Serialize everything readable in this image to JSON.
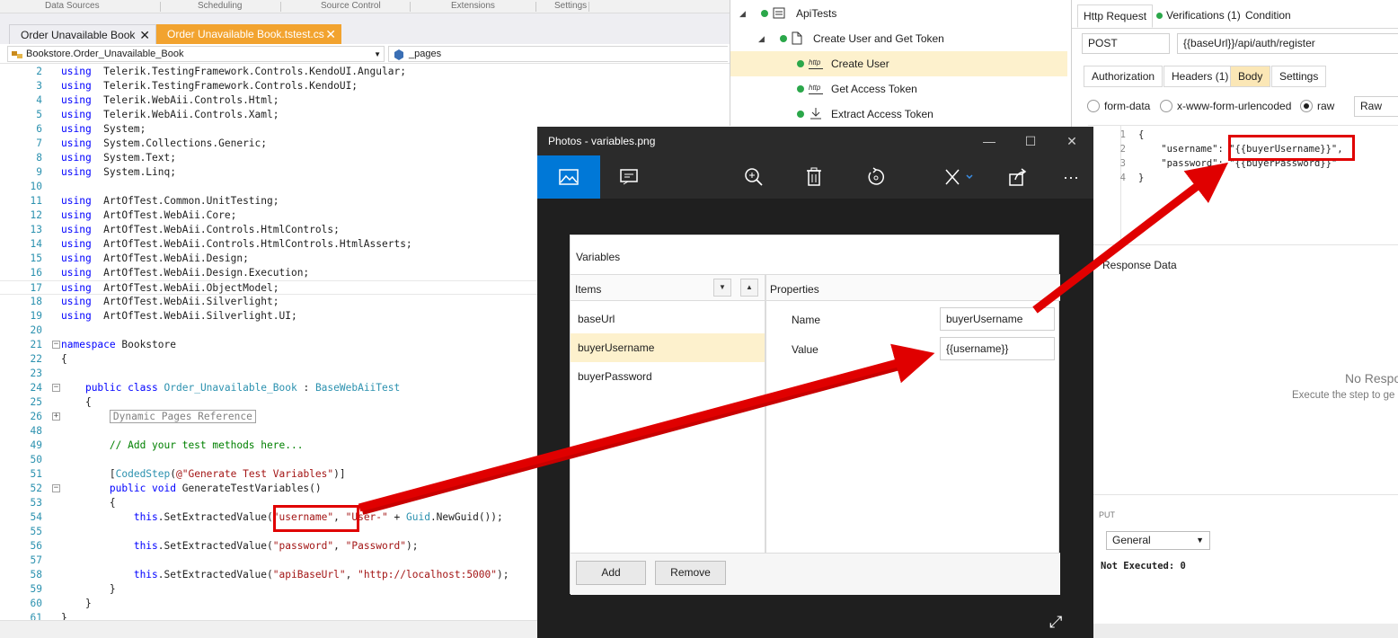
{
  "ribbon": [
    "Data Sources",
    "Scheduling",
    "Source Control",
    "Extensions",
    "Settings"
  ],
  "editor": {
    "tabs": [
      {
        "label": "Order Unavailable Book",
        "close": "✕"
      },
      {
        "label": "Order Unavailable Book.tstest.cs",
        "close": "✕"
      }
    ],
    "nav_class": "Bookstore.Order_Unavailable_Book",
    "nav_member": "_pages",
    "lines": [
      {
        "n": "2",
        "t": [
          [
            "kw",
            "using"
          ],
          [
            "",
            "  Telerik.TestingFramework.Controls.KendoUI.Angular;"
          ]
        ]
      },
      {
        "n": "3",
        "t": [
          [
            "kw",
            "using"
          ],
          [
            "",
            "  Telerik.TestingFramework.Controls.KendoUI;"
          ]
        ]
      },
      {
        "n": "4",
        "t": [
          [
            "kw",
            "using"
          ],
          [
            "",
            "  Telerik.WebAii.Controls.Html;"
          ]
        ]
      },
      {
        "n": "5",
        "t": [
          [
            "kw",
            "using"
          ],
          [
            "",
            "  Telerik.WebAii.Controls.Xaml;"
          ]
        ]
      },
      {
        "n": "6",
        "t": [
          [
            "kw",
            "using"
          ],
          [
            "",
            "  System;"
          ]
        ]
      },
      {
        "n": "7",
        "t": [
          [
            "kw",
            "using"
          ],
          [
            "",
            "  System.Collections.Generic;"
          ]
        ]
      },
      {
        "n": "8",
        "t": [
          [
            "kw",
            "using"
          ],
          [
            "",
            "  System.Text;"
          ]
        ]
      },
      {
        "n": "9",
        "t": [
          [
            "kw",
            "using"
          ],
          [
            "",
            "  System.Linq;"
          ]
        ]
      },
      {
        "n": "10",
        "t": []
      },
      {
        "n": "11",
        "t": [
          [
            "kw",
            "using"
          ],
          [
            "",
            "  ArtOfTest.Common.UnitTesting;"
          ]
        ]
      },
      {
        "n": "12",
        "t": [
          [
            "kw",
            "using"
          ],
          [
            "",
            "  ArtOfTest.WebAii.Core;"
          ]
        ]
      },
      {
        "n": "13",
        "t": [
          [
            "kw",
            "using"
          ],
          [
            "",
            "  ArtOfTest.WebAii.Controls.HtmlControls;"
          ]
        ]
      },
      {
        "n": "14",
        "t": [
          [
            "kw",
            "using"
          ],
          [
            "",
            "  ArtOfTest.WebAii.Controls.HtmlControls.HtmlAsserts;"
          ]
        ]
      },
      {
        "n": "15",
        "t": [
          [
            "kw",
            "using"
          ],
          [
            "",
            "  ArtOfTest.WebAii.Design;"
          ]
        ]
      },
      {
        "n": "16",
        "t": [
          [
            "kw",
            "using"
          ],
          [
            "",
            "  ArtOfTest.WebAii.Design.Execution;"
          ]
        ]
      },
      {
        "n": "17",
        "t": [
          [
            "kw",
            "using"
          ],
          [
            "",
            "  ArtOfTest.WebAii.ObjectModel;"
          ]
        ]
      },
      {
        "n": "18",
        "t": [
          [
            "kw",
            "using"
          ],
          [
            "",
            "  ArtOfTest.WebAii.Silverlight;"
          ]
        ]
      },
      {
        "n": "19",
        "t": [
          [
            "kw",
            "using"
          ],
          [
            "",
            "  ArtOfTest.WebAii.Silverlight.UI;"
          ]
        ]
      },
      {
        "n": "20",
        "t": []
      },
      {
        "n": "21",
        "t": [
          [
            "kw",
            "namespace"
          ],
          [
            "",
            " Bookstore"
          ]
        ]
      },
      {
        "n": "22",
        "t": [
          [
            "",
            "{"
          ]
        ]
      },
      {
        "n": "23",
        "t": []
      },
      {
        "n": "24",
        "t": [
          [
            "",
            "    "
          ],
          [
            "kw",
            "public class"
          ],
          [
            "",
            " "
          ],
          [
            "ty",
            "Order_Unavailable_Book"
          ],
          [
            "",
            " : "
          ],
          [
            "ty",
            "BaseWebAiiTest"
          ]
        ]
      },
      {
        "n": "25",
        "t": [
          [
            "",
            "    {"
          ]
        ]
      },
      {
        "n": "26",
        "t": [
          [
            "",
            "        "
          ],
          [
            "box",
            "Dynamic Pages Reference"
          ]
        ]
      },
      {
        "n": "48",
        "t": []
      },
      {
        "n": "49",
        "t": [
          [
            "",
            "        "
          ],
          [
            "cm",
            "// Add your test methods here..."
          ]
        ]
      },
      {
        "n": "50",
        "t": []
      },
      {
        "n": "51",
        "t": [
          [
            "",
            "        ["
          ],
          [
            "ty",
            "CodedStep"
          ],
          [
            "",
            "("
          ],
          [
            "str",
            "@\"Generate Test Variables\""
          ],
          [
            "",
            ")]"
          ]
        ]
      },
      {
        "n": "52",
        "t": [
          [
            "",
            "        "
          ],
          [
            "kw",
            "public void"
          ],
          [
            "",
            " GenerateTestVariables()"
          ]
        ]
      },
      {
        "n": "53",
        "t": [
          [
            "",
            "        {"
          ]
        ]
      },
      {
        "n": "54",
        "t": [
          [
            "",
            "            "
          ],
          [
            "kw",
            "this"
          ],
          [
            "",
            ".SetExtractedValue("
          ],
          [
            "str",
            "\"username\""
          ],
          [
            "",
            ", "
          ],
          [
            "str",
            "\"User-\""
          ],
          [
            "",
            " + "
          ],
          [
            "ty",
            "Guid"
          ],
          [
            "",
            ".NewGuid());"
          ]
        ]
      },
      {
        "n": "55",
        "t": []
      },
      {
        "n": "56",
        "t": [
          [
            "",
            "            "
          ],
          [
            "kw",
            "this"
          ],
          [
            "",
            ".SetExtractedValue("
          ],
          [
            "str",
            "\"password\""
          ],
          [
            "",
            ", "
          ],
          [
            "str",
            "\"Password\""
          ],
          [
            "",
            ");"
          ]
        ]
      },
      {
        "n": "57",
        "t": []
      },
      {
        "n": "58",
        "t": [
          [
            "",
            "            "
          ],
          [
            "kw",
            "this"
          ],
          [
            "",
            ".SetExtractedValue("
          ],
          [
            "str",
            "\"apiBaseUrl\""
          ],
          [
            "",
            ", "
          ],
          [
            "str",
            "\"http://localhost:5000\""
          ],
          [
            "",
            ");"
          ]
        ]
      },
      {
        "n": "59",
        "t": [
          [
            "",
            "        }"
          ]
        ]
      },
      {
        "n": "60",
        "t": [
          [
            "",
            "    }"
          ]
        ]
      },
      {
        "n": "61",
        "t": [
          [
            "",
            "}"
          ]
        ]
      }
    ]
  },
  "tree": {
    "items": [
      {
        "label": "ApiTests"
      },
      {
        "label": "Create User and Get Token"
      },
      {
        "label": "Create User"
      },
      {
        "label": "Get Access Token"
      },
      {
        "label": "Extract Access Token"
      }
    ]
  },
  "http": {
    "tabs": [
      "Http Request",
      "Verifications (1)",
      "Condition"
    ],
    "method": "POST",
    "url": "{{baseUrl}}/api/auth/register",
    "subtabs": [
      "Authorization",
      "Headers (1)",
      "Body",
      "Settings"
    ],
    "radios": [
      "form-data",
      "x-www-form-urlencoded",
      "raw"
    ],
    "body_format": "Raw",
    "body_lines": [
      {
        "n": "1",
        "code": "{"
      },
      {
        "n": "2",
        "code": "    \"username\": \"{{buyerUsername}}\","
      },
      {
        "n": "3",
        "code": "    \"password\": \"{{buyerPassword}}\""
      },
      {
        "n": "4",
        "code": "}"
      }
    ],
    "response_label": "Response Data",
    "no_response": "No Respo",
    "no_response_hint": "Execute the step to ge",
    "output_label": "PUT",
    "output_select": "General",
    "not_executed": "Not Executed: 0"
  },
  "photos": {
    "title": "Photos - variables.png",
    "window_controls": [
      "—",
      "☐",
      "✕"
    ],
    "toolbar_icons": [
      "image-view-icon",
      "slideshow-icon",
      "zoom-in-icon",
      "delete-icon",
      "rotate-icon",
      "edit-icon",
      "share-icon",
      "more-icon"
    ],
    "more": "···",
    "accent": "#0078d7",
    "dialog": {
      "title": "Variables",
      "items_header": "Items",
      "properties_header": "Properties",
      "items": [
        "baseUrl",
        "buyerUsername",
        "buyerPassword"
      ],
      "name_label": "Name",
      "name_value": "buyerUsername",
      "value_label": "Value",
      "value_value": "{{username}}",
      "add": "Add",
      "remove": "Remove"
    }
  },
  "highlight_color": "#e00000"
}
